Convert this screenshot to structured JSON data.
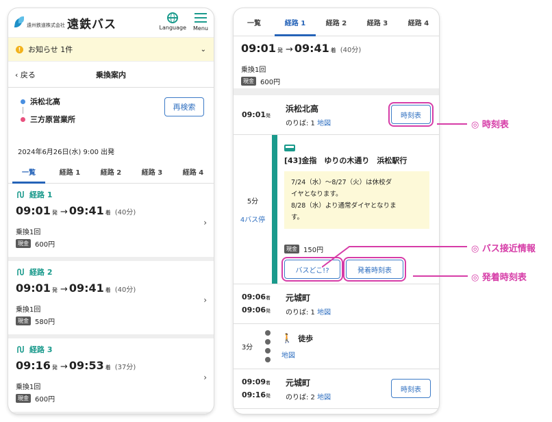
{
  "left": {
    "logo_company": "遠州鉄道株式会社",
    "logo_brand": "遠鉄バス",
    "language_label": "Language",
    "menu_label": "Menu",
    "notice": "お知らせ 1件",
    "back_label": "戻る",
    "page_title": "乗換案内",
    "from_stop": "浜松北高",
    "to_stop": "三方原営業所",
    "research_label": "再検索",
    "datetime": "2024年6月26日(水) 9:00  出発",
    "tabs": [
      "一覧",
      "経路 1",
      "経路 2",
      "経路 3",
      "経路 4"
    ],
    "routes": [
      {
        "label": "経路 1",
        "dep": "09:01",
        "arr": "09:41",
        "dur": "(40分)",
        "xfer": "乗換1回",
        "fare": "600円"
      },
      {
        "label": "経路 2",
        "dep": "09:01",
        "arr": "09:41",
        "dur": "(40分)",
        "xfer": "乗換1回",
        "fare": "580円"
      },
      {
        "label": "経路 3",
        "dep": "09:16",
        "arr": "09:53",
        "dur": "(37分)",
        "xfer": "乗換1回",
        "fare": "600円"
      }
    ],
    "dep_suffix": "発",
    "arr_suffix": "着",
    "cash_label": "現金"
  },
  "right": {
    "tabs": [
      "一覧",
      "経路 1",
      "経路 2",
      "経路 3",
      "経路 4"
    ],
    "summary": {
      "dep": "09:01",
      "arr": "09:41",
      "dur": "(40分)",
      "xfer": "乗換1回",
      "fare": "600円"
    },
    "stop1": {
      "time": "09:01",
      "name": "浜松北高",
      "platform": "のりば: 1",
      "map": "地図",
      "tt_label": "時刻表"
    },
    "ride": {
      "duration": "5分",
      "stops": "4バス停",
      "line": "[43]金指　ゆりの木通り　浜松駅行",
      "notice_lines": [
        "7/24（水）～8/27（火）は休校ダ",
        "イヤとなります。",
        "8/28（水）より通常ダイヤとなりま",
        "す。"
      ],
      "fare": "150円",
      "btn_approach": "バスどこ!?",
      "btn_timetable": "発着時刻表"
    },
    "stop2": {
      "arr_time": "09:06",
      "dep_time": "09:06",
      "name": "元城町",
      "platform": "のりば: 1",
      "map": "地図"
    },
    "walk": {
      "duration": "3分",
      "label": "徒歩",
      "map": "地図"
    },
    "stop3": {
      "arr_time": "09:09",
      "dep_time": "09:16",
      "name": "元城町",
      "platform": "のりば: 2",
      "map": "地図",
      "tt_label": "時刻表"
    }
  },
  "callouts": {
    "timetable": "◎ 時刻表",
    "approach": "◎ バス接近情報",
    "departures": "◎ 発着時刻表"
  },
  "colors": {
    "accent_blue": "#2563b8",
    "teal": "#1a9a8c",
    "callout_magenta": "#d63ca7",
    "notice_bg": "#fdf9d8"
  }
}
